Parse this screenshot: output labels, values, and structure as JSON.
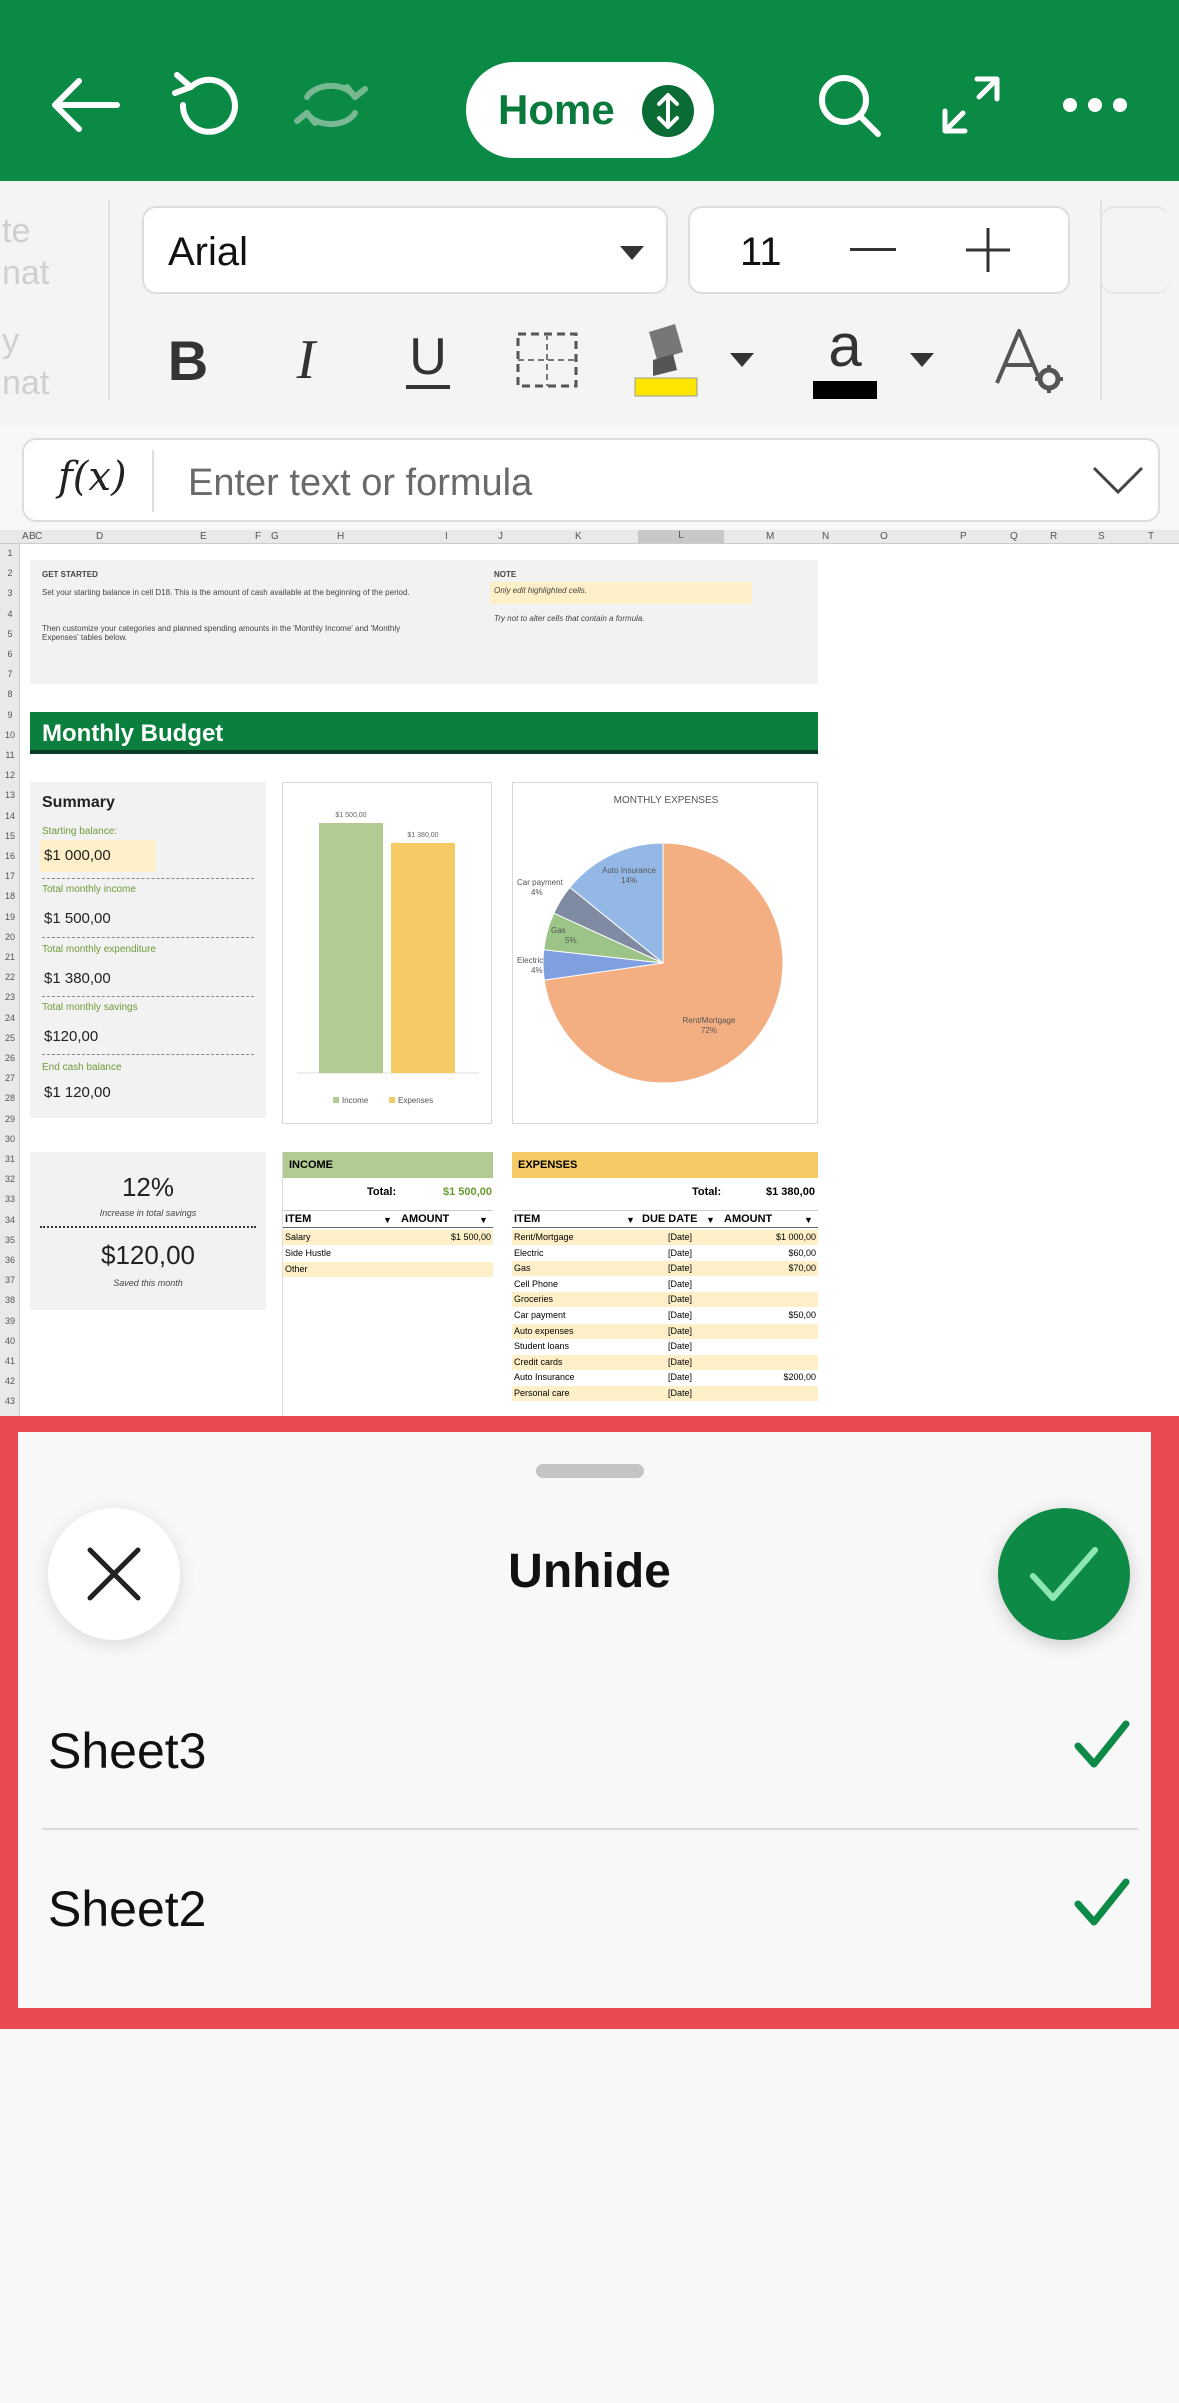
{
  "toolbar": {
    "tab_label": "Home",
    "icons": [
      "back-icon",
      "undo-icon",
      "redo-icon",
      "search-icon",
      "fullscreen-icon",
      "more-icon"
    ]
  },
  "ribbon": {
    "left_faded_1a": "te",
    "left_faded_1b": "nat",
    "left_faded_2a": "y",
    "left_faded_2b": "nat",
    "font_name": "Arial",
    "font_size": "11",
    "bold_label": "B",
    "italic_label": "I",
    "underline_label": "U",
    "font_color_letter": "a",
    "colors": {
      "highlight": "#ffe600",
      "font": "#000000"
    }
  },
  "formula_bar": {
    "fx_label": "f(x)",
    "placeholder": "Enter text or formula"
  },
  "sheet": {
    "columns": [
      "A",
      "B",
      "C",
      "D",
      "E",
      "F",
      "G",
      "H",
      "I",
      "J",
      "K",
      "L",
      "M",
      "N",
      "O",
      "P",
      "Q",
      "R",
      "S",
      "T"
    ],
    "rows": [
      "1",
      "2",
      "3",
      "4",
      "5",
      "6",
      "7",
      "8",
      "9",
      "10",
      "11",
      "12",
      "13",
      "14",
      "15",
      "16",
      "17",
      "18",
      "19",
      "20",
      "21",
      "22",
      "23",
      "24",
      "25",
      "26",
      "27",
      "28",
      "29",
      "30",
      "31",
      "32",
      "33",
      "34",
      "35",
      "36",
      "37",
      "38",
      "39",
      "40",
      "41",
      "42",
      "43"
    ],
    "get_started": {
      "heading": "GET STARTED",
      "text1": "Set your starting balance in cell D18. This is the amount of cash available at the beginning of the period.",
      "text2": "Then customize your categories and planned spending amounts in the 'Monthly Income' and 'Monthly Expenses' tables below."
    },
    "note": {
      "heading": "NOTE",
      "text1": "Only edit highlighted cells.",
      "text2": "Try not to alter cells that contain a formula."
    },
    "banner": "Monthly Budget",
    "summary": {
      "title": "Summary",
      "items": [
        {
          "label": "Starting balance:",
          "value": "$1 000,00"
        },
        {
          "label": "Total monthly income",
          "value": "$1 500,00"
        },
        {
          "label": "Total monthly expenditure",
          "value": "$1 380,00"
        },
        {
          "label": "Total monthly savings",
          "value": "$120,00"
        },
        {
          "label": "End cash balance",
          "value": "$1 120,00"
        }
      ]
    },
    "savings": {
      "pct": "12%",
      "pct_caption": "Increase in total savings",
      "amount": "$120,00",
      "amount_caption": "Saved this month"
    },
    "income": {
      "title": "INCOME",
      "total_label": "Total:",
      "total_value": "$1 500,00",
      "col_item": "ITEM",
      "col_amount": "AMOUNT",
      "rows": [
        {
          "item": "Salary",
          "amount": "$1 500,00"
        },
        {
          "item": "Side Hustle",
          "amount": ""
        },
        {
          "item": "Other",
          "amount": ""
        }
      ]
    },
    "expenses": {
      "title": "EXPENSES",
      "total_label": "Total:",
      "total_value": "$1 380,00",
      "col_item": "ITEM",
      "col_due": "DUE DATE",
      "col_amount": "AMOUNT",
      "rows": [
        {
          "item": "Rent/Mortgage",
          "due": "[Date]",
          "amount": "$1 000,00"
        },
        {
          "item": "Electric",
          "due": "[Date]",
          "amount": "$60,00"
        },
        {
          "item": "Gas",
          "due": "[Date]",
          "amount": "$70,00"
        },
        {
          "item": "Cell Phone",
          "due": "[Date]",
          "amount": ""
        },
        {
          "item": "Groceries",
          "due": "[Date]",
          "amount": ""
        },
        {
          "item": "Car payment",
          "due": "[Date]",
          "amount": "$50,00"
        },
        {
          "item": "Auto expenses",
          "due": "[Date]",
          "amount": ""
        },
        {
          "item": "Student loans",
          "due": "[Date]",
          "amount": ""
        },
        {
          "item": "Credit cards",
          "due": "[Date]",
          "amount": ""
        },
        {
          "item": "Auto Insurance",
          "due": "[Date]",
          "amount": "$200,00"
        },
        {
          "item": "Personal care",
          "due": "[Date]",
          "amount": ""
        }
      ]
    }
  },
  "chart_data": [
    {
      "type": "bar",
      "categories": [
        "Income",
        "Expenses"
      ],
      "values": [
        1500,
        1380
      ],
      "data_labels": [
        "$1 500,00",
        "$1 380,00"
      ],
      "legend": [
        "Income",
        "Expenses"
      ],
      "colors": [
        "#b1cb93",
        "#f6ca64"
      ]
    },
    {
      "type": "pie",
      "title": "MONTHLY EXPENSES",
      "slices": [
        {
          "label": "Rent/Mortgage",
          "value": 72,
          "display": "72%",
          "color": "#f3ae82"
        },
        {
          "label": "Electric",
          "value": 4,
          "display": "4%",
          "color": "#7f9fe0"
        },
        {
          "label": "Gas",
          "value": 5,
          "display": "5%",
          "color": "#9cc486"
        },
        {
          "label": "Car payment",
          "value": 4,
          "display": "4%",
          "color": "#7f8aa3"
        },
        {
          "label": "Auto Insurance",
          "value": 14,
          "display": "14%",
          "color": "#94b8e6"
        }
      ]
    }
  ],
  "unhide_panel": {
    "title": "Unhide",
    "sheets": [
      {
        "name": "Sheet3",
        "checked": true
      },
      {
        "name": "Sheet2",
        "checked": true
      }
    ],
    "colors": {
      "accent": "#0e8a47",
      "frame": "#e84a4f"
    }
  }
}
